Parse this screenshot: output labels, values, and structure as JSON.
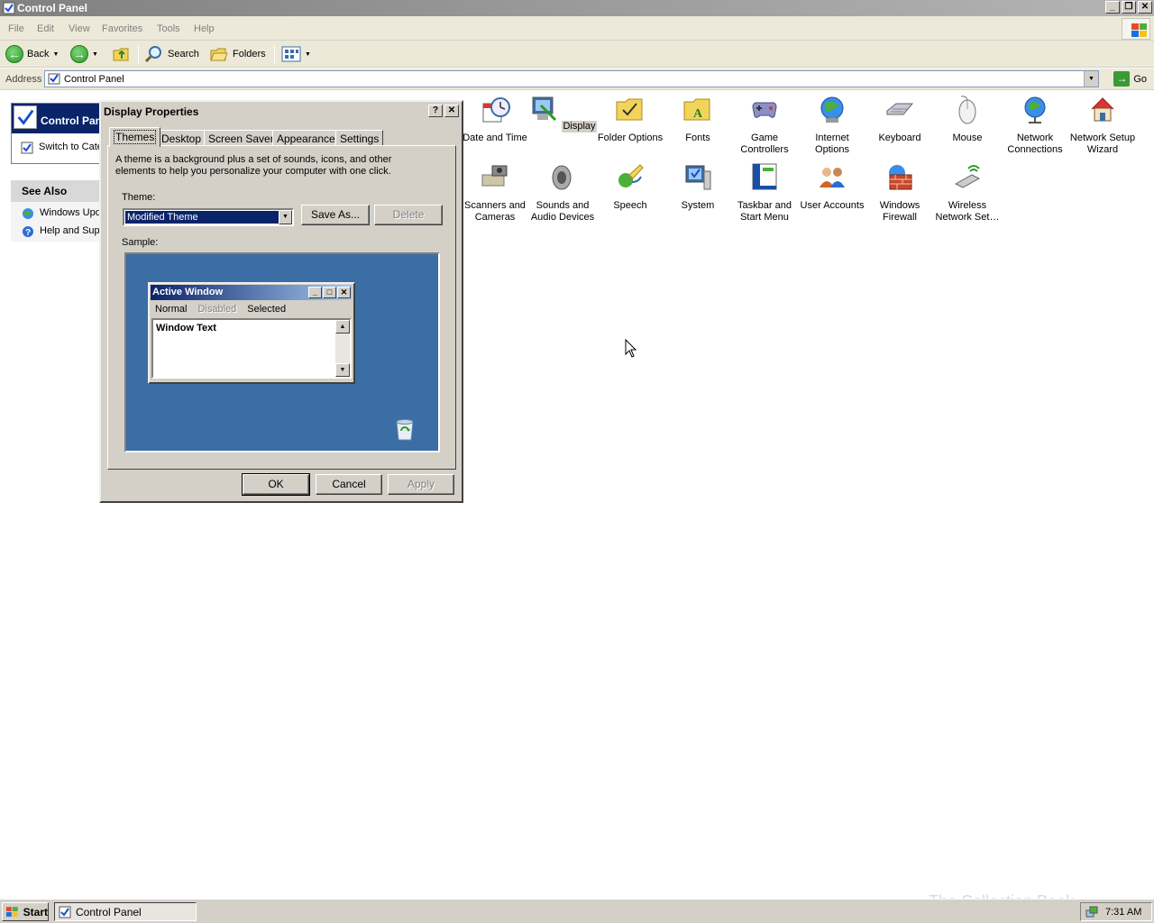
{
  "window": {
    "title": "Control Panel"
  },
  "menu": [
    "File",
    "Edit",
    "View",
    "Favorites",
    "Tools",
    "Help"
  ],
  "toolbar": {
    "back": "Back",
    "search": "Search",
    "folders": "Folders"
  },
  "address": {
    "label": "Address",
    "value": "Control Panel",
    "go": "Go"
  },
  "taskpane": {
    "title": "Control Panel",
    "switch_label": "Switch to Category View",
    "see_also_title": "See Also",
    "see_also": [
      "Windows Update",
      "Help and Support"
    ]
  },
  "icons_row1": [
    "Date and Time",
    "Display",
    "Folder Options",
    "Fonts",
    "Game Controllers",
    "Internet Options",
    "Keyboard",
    "Mouse",
    "Network Connections",
    "Network Setup Wizard"
  ],
  "icons_row2": [
    "Scanners and Cameras",
    "Sounds and Audio Devices",
    "Speech",
    "System",
    "Taskbar and Start Menu",
    "User Accounts",
    "Windows Firewall",
    "Wireless Network Set…"
  ],
  "dialog": {
    "title": "Display Properties",
    "help_btn": "?",
    "close_btn": "✕",
    "tabs": [
      "Themes",
      "Desktop",
      "Screen Saver",
      "Appearance",
      "Settings"
    ],
    "description": "A theme is a background plus a set of sounds, icons, and other elements to help you personalize your computer with one click.",
    "theme_label": "Theme:",
    "theme_value": "Modified Theme",
    "save_as": "Save As...",
    "delete": "Delete",
    "sample_label": "Sample:",
    "sample": {
      "window_title": "Active Window",
      "menu_normal": "Normal",
      "menu_disabled": "Disabled",
      "menu_selected": "Selected",
      "window_text": "Window Text"
    },
    "ok": "OK",
    "cancel": "Cancel",
    "apply": "Apply"
  },
  "taskbar": {
    "start": "Start",
    "task": "Control Panel",
    "clock": "7:31 AM"
  },
  "watermark": "The Collection Book"
}
